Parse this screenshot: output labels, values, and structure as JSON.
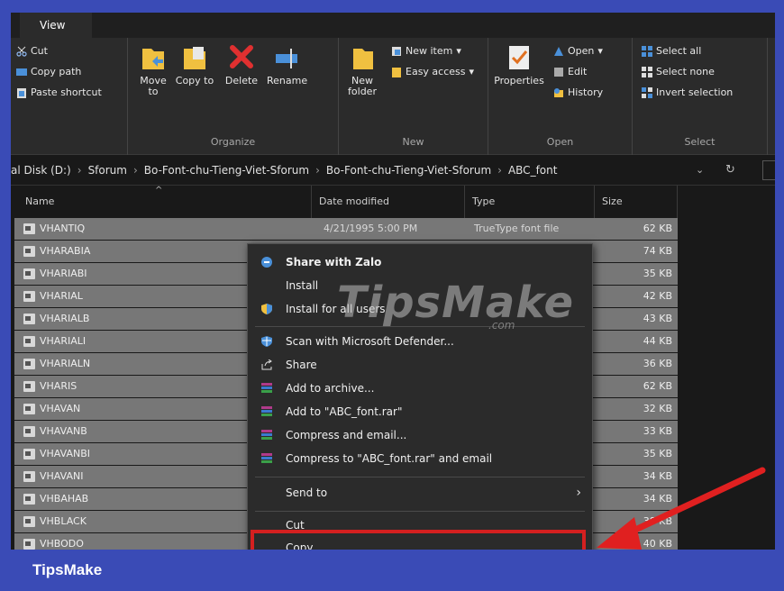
{
  "ribbon": {
    "active_tab": "View",
    "clipboard": {
      "cut": "Cut",
      "copy_path": "Copy path",
      "paste_shortcut": "Paste shortcut"
    },
    "organize": {
      "label": "Organize",
      "move_to": "Move to",
      "copy_to": "Copy to",
      "delete": "Delete",
      "rename": "Rename"
    },
    "new": {
      "label": "New",
      "new_folder": "New folder",
      "new_item": "New item",
      "easy_access": "Easy access"
    },
    "open": {
      "label": "Open",
      "properties": "Properties",
      "open": "Open",
      "edit": "Edit",
      "history": "History"
    },
    "select": {
      "label": "Select",
      "select_all": "Select all",
      "select_none": "Select none",
      "invert_selection": "Invert selection"
    }
  },
  "address": {
    "crumbs": [
      "al Disk (D:)",
      "Sforum",
      "Bo-Font-chu-Tieng-Viet-Sforum",
      "Bo-Font-chu-Tieng-Viet-Sforum",
      "ABC_font"
    ]
  },
  "columns": {
    "name": "Name",
    "date": "Date modified",
    "type": "Type",
    "size": "Size"
  },
  "files": [
    {
      "name": "VHANTIQ",
      "date": "4/21/1995 5:00 PM",
      "type": "TrueType font file",
      "size": "62 KB"
    },
    {
      "name": "VHARABIA",
      "size": "74 KB"
    },
    {
      "name": "VHARIABI",
      "size": "35 KB"
    },
    {
      "name": "VHARIAL",
      "size": "42 KB"
    },
    {
      "name": "VHARIALB",
      "size": "43 KB"
    },
    {
      "name": "VHARIALI",
      "size": "44 KB"
    },
    {
      "name": "VHARIALN",
      "size": "36 KB"
    },
    {
      "name": "VHARIS",
      "size": "62 KB"
    },
    {
      "name": "VHAVAN",
      "size": "32 KB"
    },
    {
      "name": "VHAVANB",
      "size": "33 KB"
    },
    {
      "name": "VHAVANBI",
      "size": "35 KB"
    },
    {
      "name": "VHAVANI",
      "size": "34 KB"
    },
    {
      "name": "VHBAHAB",
      "size": "34 KB"
    },
    {
      "name": "VHBLACK",
      "size": "38 KB"
    },
    {
      "name": "VHBODO",
      "size": "40 KB"
    }
  ],
  "context_menu": {
    "share_with_zalo": "Share with Zalo",
    "install": "Install",
    "install_all_users": "Install for all users",
    "scan_defender": "Scan with Microsoft Defender...",
    "share": "Share",
    "add_to_archive": "Add to archive...",
    "add_to_rar": "Add to \"ABC_font.rar\"",
    "compress_email": "Compress and email...",
    "compress_rar_email": "Compress to \"ABC_font.rar\" and email",
    "send_to": "Send to",
    "cut": "Cut",
    "copy": "Copy"
  },
  "watermark": {
    "main": "TipsMake",
    "sub": ".com"
  },
  "brand": "TipsMake",
  "colors": {
    "highlight": "#d42020",
    "brand_bar": "#3a4bb6",
    "selection": "#777777"
  }
}
